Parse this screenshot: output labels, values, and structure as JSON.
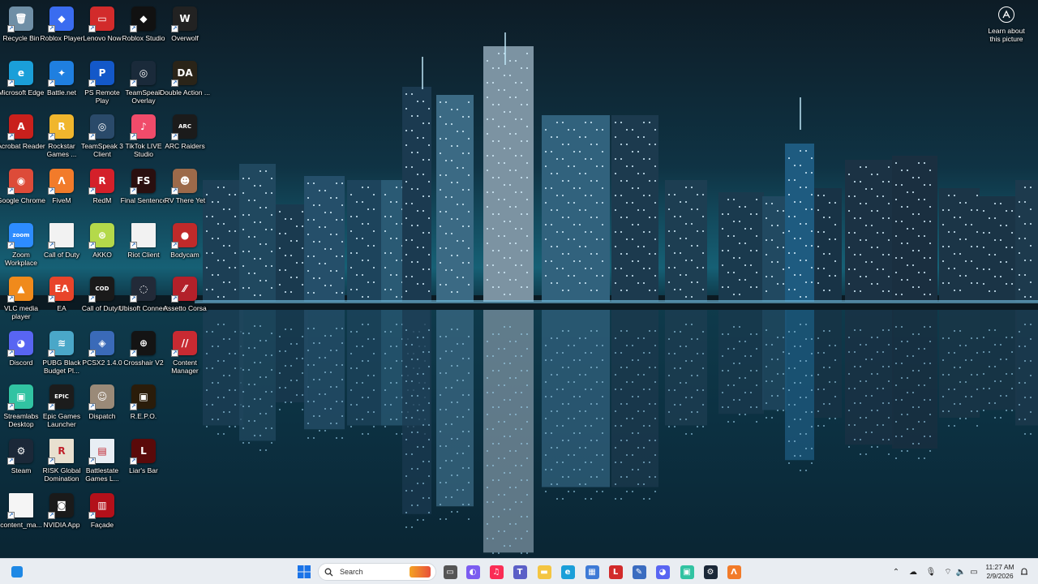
{
  "desktop": {
    "icons": [
      {
        "label": "Recycle Bin",
        "icon": "recycle-bin-icon",
        "color": "#6f8fa6",
        "glyph": "🗑"
      },
      {
        "label": "Roblox Player",
        "icon": "roblox-player-icon",
        "color": "#3a6cf0",
        "glyph": "◆"
      },
      {
        "label": "Lenovo Now",
        "icon": "lenovo-now-icon",
        "color": "#d22b2b",
        "glyph": "▭"
      },
      {
        "label": "Roblox Studio",
        "icon": "roblox-studio-icon",
        "color": "#111111",
        "glyph": "◆"
      },
      {
        "label": "Overwolf",
        "icon": "overwolf-icon",
        "color": "#222222",
        "glyph": "W"
      },
      {
        "label": "Microsoft Edge",
        "icon": "edge-icon",
        "color": "#1a9fd9",
        "glyph": "e"
      },
      {
        "label": "Battle.net",
        "icon": "battlenet-icon",
        "color": "#1f7fe0",
        "glyph": "✦"
      },
      {
        "label": "PS Remote Play",
        "icon": "ps-remote-play-icon",
        "color": "#1358c9",
        "glyph": "P"
      },
      {
        "label": "TeamSpeak Overlay",
        "icon": "teamspeak-overlay-icon",
        "color": "#1a2a3a",
        "glyph": "◎"
      },
      {
        "label": "Double Action ...",
        "icon": "double-action-icon",
        "color": "#2a2418",
        "glyph": "DA"
      },
      {
        "label": "Acrobat Reader",
        "icon": "acrobat-icon",
        "color": "#c9201c",
        "glyph": "A"
      },
      {
        "label": "Rockstar Games ...",
        "icon": "rockstar-icon",
        "color": "#f0b62d",
        "glyph": "R"
      },
      {
        "label": "TeamSpeak 3 Client",
        "icon": "teamspeak-icon",
        "color": "#2a4a6a",
        "glyph": "◎"
      },
      {
        "label": "TikTok LIVE Studio",
        "icon": "tiktok-live-icon",
        "color": "#f04b6a",
        "glyph": "♪"
      },
      {
        "label": "ARC Raiders",
        "icon": "arc-raiders-icon",
        "color": "#1b1b1b",
        "glyph": "ARC"
      },
      {
        "label": "Google Chrome",
        "icon": "chrome-icon",
        "color": "#dd4b39",
        "glyph": "◉"
      },
      {
        "label": "FiveM",
        "icon": "fivem-icon",
        "color": "#f27b2a",
        "glyph": "Λ"
      },
      {
        "label": "RedM",
        "icon": "redm-icon",
        "color": "#d4202a",
        "glyph": "R"
      },
      {
        "label": "Final Sentence",
        "icon": "final-sentence-icon",
        "color": "#2a0f0f",
        "glyph": "FS"
      },
      {
        "label": "RV There Yet",
        "icon": "rv-there-yet-icon",
        "color": "#9c6a4a",
        "glyph": "☻"
      },
      {
        "label": "Zoom Workplace",
        "icon": "zoom-icon",
        "color": "#2d8cff",
        "glyph": "zoom"
      },
      {
        "label": "Call of Duty",
        "icon": "call-of-duty-file-icon",
        "color": "#f2f2f2",
        "glyph": ""
      },
      {
        "label": "AKKO",
        "icon": "akko-icon",
        "color": "#b4d94a",
        "glyph": "⊛"
      },
      {
        "label": "Riot Client",
        "icon": "riot-client-file-icon",
        "color": "#f2f2f2",
        "glyph": ""
      },
      {
        "label": "Bodycam",
        "icon": "bodycam-icon",
        "color": "#c02a2a",
        "glyph": "●"
      },
      {
        "label": "VLC media player",
        "icon": "vlc-icon",
        "color": "#f08a1b",
        "glyph": "▲"
      },
      {
        "label": "EA",
        "icon": "ea-icon",
        "color": "#e8442a",
        "glyph": "EA"
      },
      {
        "label": "Call of Duty®",
        "icon": "call-of-duty-icon",
        "color": "#1a1a1a",
        "glyph": "COD"
      },
      {
        "label": "Ubisoft Connect",
        "icon": "ubisoft-icon",
        "color": "#222a38",
        "glyph": "◌"
      },
      {
        "label": "Assetto Corsa",
        "icon": "assetto-corsa-icon",
        "color": "#b3202a",
        "glyph": "⁄⁄"
      },
      {
        "label": "Discord",
        "icon": "discord-icon",
        "color": "#5865f2",
        "glyph": "◕"
      },
      {
        "label": "PUBG Black Budget Pl...",
        "icon": "pubg-icon",
        "color": "#4aa7c8",
        "glyph": "≋"
      },
      {
        "label": "PCSX2 1.4.0",
        "icon": "pcsx2-icon",
        "color": "#3a6ab8",
        "glyph": "◈"
      },
      {
        "label": "Crosshair V2",
        "icon": "crosshair-icon",
        "color": "#141414",
        "glyph": "⊕"
      },
      {
        "label": "Content Manager",
        "icon": "content-manager-icon",
        "color": "#c82a32",
        "glyph": "//"
      },
      {
        "label": "Streamlabs Desktop",
        "icon": "streamlabs-icon",
        "color": "#31c3a2",
        "glyph": "▣"
      },
      {
        "label": "Epic Games Launcher",
        "icon": "epic-games-icon",
        "color": "#1c1c1c",
        "glyph": "EPIC"
      },
      {
        "label": "Dispatch",
        "icon": "dispatch-icon",
        "color": "#9a8a78",
        "glyph": "☺"
      },
      {
        "label": "R.E.P.O.",
        "icon": "repo-icon",
        "color": "#2a1c0a",
        "glyph": "▣"
      },
      {
        "label": "",
        "icon": "",
        "color": "",
        "glyph": ""
      },
      {
        "label": "Steam",
        "icon": "steam-icon",
        "color": "#1b2838",
        "glyph": "⚙"
      },
      {
        "label": "RISK Global Domination",
        "icon": "risk-icon",
        "color": "#e8e0d0",
        "glyph": "R"
      },
      {
        "label": "Battlestate Games L...",
        "icon": "battlestate-icon",
        "color": "#e8eef4",
        "glyph": "▤"
      },
      {
        "label": "Liar's Bar",
        "icon": "liars-bar-icon",
        "color": "#5a0a0a",
        "glyph": "L"
      },
      {
        "label": "",
        "icon": "",
        "color": "",
        "glyph": ""
      },
      {
        "label": "content_ma...",
        "icon": "text-file-icon",
        "color": "#f5f5f5",
        "glyph": ""
      },
      {
        "label": "NVIDIA App",
        "icon": "nvidia-icon",
        "color": "#1a1a1a",
        "glyph": "◙"
      },
      {
        "label": "Façade",
        "icon": "facade-icon",
        "color": "#b3101a",
        "glyph": "▥"
      }
    ]
  },
  "learn": {
    "label": "Learn about this picture",
    "icon": "camera-info-icon"
  },
  "taskbar": {
    "search_label": "Search",
    "apps": [
      {
        "name": "start-button",
        "icon": "windows-logo-icon",
        "color": "#1a73e8",
        "glyph": ""
      },
      {
        "name": "task-view-button",
        "icon": "task-view-icon",
        "color": "#555555",
        "glyph": "▭"
      },
      {
        "name": "copilot-button",
        "icon": "copilot-icon",
        "color": "#7b5cf0",
        "glyph": "◐"
      },
      {
        "name": "music-button",
        "icon": "music-icon",
        "color": "#fa2d55",
        "glyph": "♫"
      },
      {
        "name": "teams-button",
        "icon": "teams-icon",
        "color": "#5b5fc7",
        "glyph": "T"
      },
      {
        "name": "file-explorer-button",
        "icon": "folder-icon",
        "color": "#f4c542",
        "glyph": "▬"
      },
      {
        "name": "edge-button",
        "icon": "edge-icon",
        "color": "#1a9fd9",
        "glyph": "e"
      },
      {
        "name": "store-button",
        "icon": "store-icon",
        "color": "#3d7ad6",
        "glyph": "▦"
      },
      {
        "name": "lenovo-button",
        "icon": "lenovo-icon",
        "color": "#d22b2b",
        "glyph": "L"
      },
      {
        "name": "app-button",
        "icon": "pen-icon",
        "color": "#3a6cc0",
        "glyph": "✎"
      },
      {
        "name": "discord-button",
        "icon": "discord-icon",
        "color": "#5865f2",
        "glyph": "◕"
      },
      {
        "name": "streamlabs-button",
        "icon": "streamlabs-icon",
        "color": "#31c3a2",
        "glyph": "▣"
      },
      {
        "name": "steam-button",
        "icon": "steam-icon",
        "color": "#1b2838",
        "glyph": "⚙"
      },
      {
        "name": "fivem-button",
        "icon": "fivem-icon",
        "color": "#f27b2a",
        "glyph": "Λ"
      }
    ],
    "tray": [
      {
        "name": "show-hidden-icons",
        "icon": "chevron-up-icon",
        "glyph": "⌃"
      },
      {
        "name": "onedrive-tray",
        "icon": "cloud-icon",
        "glyph": "☁"
      },
      {
        "name": "mic-tray",
        "icon": "microphone-icon",
        "glyph": "🎙"
      },
      {
        "name": "wifi-tray",
        "icon": "wifi-icon",
        "glyph": "⌔"
      },
      {
        "name": "volume-tray",
        "icon": "speaker-icon",
        "glyph": "🔈"
      },
      {
        "name": "battery-tray",
        "icon": "battery-icon",
        "glyph": "▭"
      }
    ],
    "time": "11:27 AM",
    "date": "2/9/2026"
  }
}
